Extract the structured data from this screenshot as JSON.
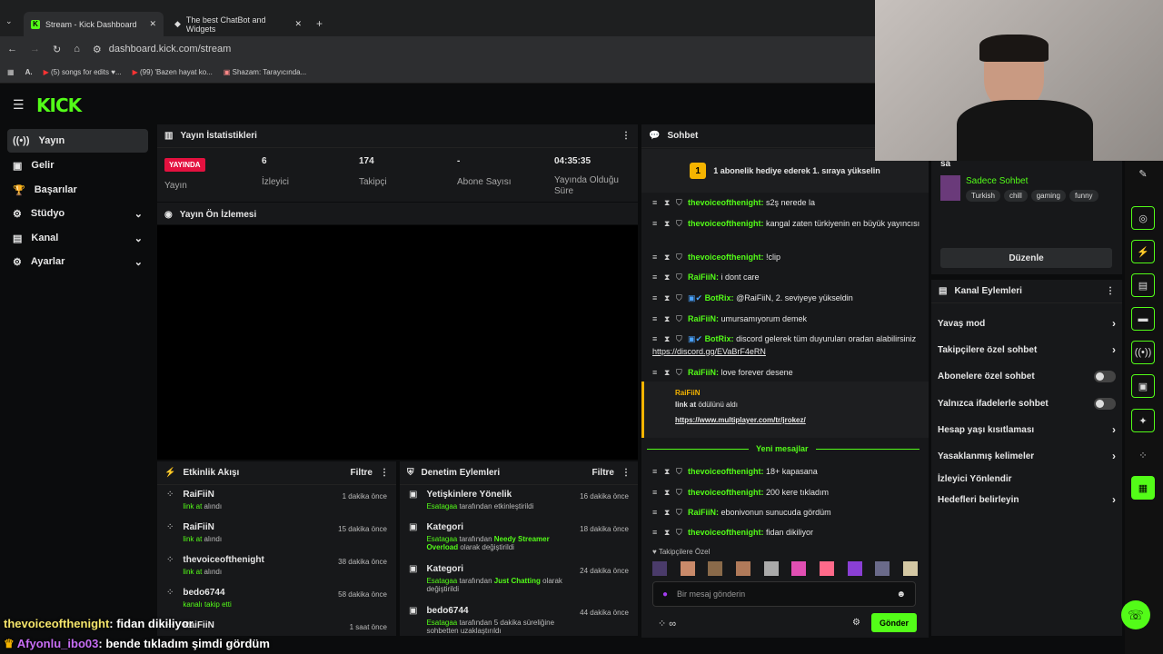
{
  "browser": {
    "tab1": "Stream - Kick Dashboard",
    "tab2": "The best ChatBot and Widgets",
    "url": "dashboard.kick.com/stream",
    "bookmarks": [
      "(5) songs for edits ♥...",
      "(99) 'Bazen hayat ko...",
      "Shazam: Tarayıcında..."
    ]
  },
  "logo": "KICK",
  "nav": [
    "Yayın",
    "Gelir",
    "Başarılar",
    "Stüdyo",
    "Kanal",
    "Ayarlar"
  ],
  "stats": {
    "title": "Yayın İstatistikleri",
    "live_badge": "YAYINDA",
    "live_label": "Yayın",
    "viewers": "6",
    "viewers_label": "İzleyici",
    "followers": "174",
    "followers_label": "Takipçi",
    "subs": "-",
    "subs_label": "Abone Sayısı",
    "uptime": "04:35:35",
    "uptime_label": "Yayında Olduğu Süre"
  },
  "preview": {
    "title": "Yayın Ön İzlemesi"
  },
  "activity": {
    "title": "Etkinlik Akışı",
    "filter": "Filtre",
    "items": [
      {
        "name": "RaiFiiN",
        "text": "link at",
        "suffix": "alındı",
        "time": "1 dakika önce"
      },
      {
        "name": "RaiFiiN",
        "text": "link at",
        "suffix": "alındı",
        "time": "15 dakika önce"
      },
      {
        "name": "thevoiceofthenight",
        "text": "link at",
        "suffix": "alındı",
        "time": "38 dakika önce"
      },
      {
        "name": "bedo6744",
        "text": "kanalı takip etti",
        "suffix": "",
        "time": "58 dakika önce"
      },
      {
        "name": "RaiFiiN",
        "text": "",
        "suffix": "",
        "time": "1 saat önce"
      }
    ]
  },
  "moderation": {
    "title": "Denetim Eylemleri",
    "filter": "Filtre",
    "items": [
      {
        "name": "Yetişkinlere Yönelik",
        "by": "Esatagaa",
        "text": "tarafından etkinleştirildi",
        "time": "16 dakika önce"
      },
      {
        "name": "Kategori",
        "by": "Esatagaa",
        "text": "tarafından",
        "hl": "Needy Streamer Overload",
        "text2": "olarak değiştirildi",
        "time": "18 dakika önce"
      },
      {
        "name": "Kategori",
        "by": "Esatagaa",
        "text": "tarafından",
        "hl": "Just Chatting",
        "text2": "olarak değiştirildi",
        "time": "24 dakika önce"
      },
      {
        "name": "bedo6744",
        "by": "Esatagaa",
        "text": "tarafından 5 dakika süreliğine sohbetten uzaklaştırıldı",
        "time": "44 dakika önce"
      }
    ]
  },
  "chat": {
    "title": "Sohbet",
    "goal": "1 abonelik hediye ederek 1. sıraya yükselin",
    "messages": [
      {
        "u": "thevoiceofthenight:",
        "m": "s2ş nerede la"
      },
      {
        "u": "thevoiceofthenight:",
        "m": "kangal zaten türkiyenin en büyük yayıncısı"
      },
      {
        "u": "thevoiceofthenight:",
        "m": "!clip"
      },
      {
        "u": "RaiFiiN:",
        "m": "i dont care"
      },
      {
        "u": "BotRix:",
        "m": "@RaiFiiN, 2. seviyeye yükseldin"
      },
      {
        "u": "RaiFiiN:",
        "m": "umursamıyorum demek"
      },
      {
        "u": "BotRix:",
        "m": "discord gelerek tüm duyuruları oradan alabilirsiniz",
        "link": "https://discord.gg/EVaBrF4eRN"
      },
      {
        "u": "RaiFiiN:",
        "m": "love forever desene"
      }
    ],
    "reward": {
      "user": "RaiFiiN",
      "name": "link at",
      "text": "ödülünü aldı",
      "link": "https://www.multiplayer.com/tr/jrokez/"
    },
    "new_label": "Yeni mesajlar",
    "new_messages": [
      {
        "u": "thevoiceofthenight:",
        "m": "18+ kapasana"
      },
      {
        "u": "thevoiceofthenight:",
        "m": "200 kere tıkladım"
      },
      {
        "u": "RaiFiiN:",
        "m": "ebonivonun sunucuda gördüm"
      },
      {
        "u": "thevoiceofthenight:",
        "m": "fidan dikiliyor"
      }
    ],
    "emote_label": "Takipçilere Özel",
    "input_placeholder": "Bir mesaj gönderin",
    "send": "Gönder"
  },
  "channel": {
    "partial": "sa",
    "category": "Sadece Sohbet",
    "tags": [
      "Turkish",
      "chill",
      "gaming",
      "funny"
    ],
    "edit": "Düzenle",
    "actions_title": "Kanal Eylemleri",
    "actions": [
      "Yavaş mod",
      "Takipçilere özel sohbet",
      "Abonelere özel sohbet",
      "Yalnızca ifadelerle sohbet",
      "Hesap yaşı kısıtlaması",
      "Yasaklanmış kelimeler",
      "İzleyici Yönlendir",
      "Hedefleri belirleyin"
    ]
  },
  "overlay": [
    {
      "u": "thevoiceofthenight",
      "m": ": fidan dikiliyor"
    },
    {
      "u": "Afyonlu_ibo03",
      "m": ": bende tıkladım şimdi gördüm"
    }
  ]
}
